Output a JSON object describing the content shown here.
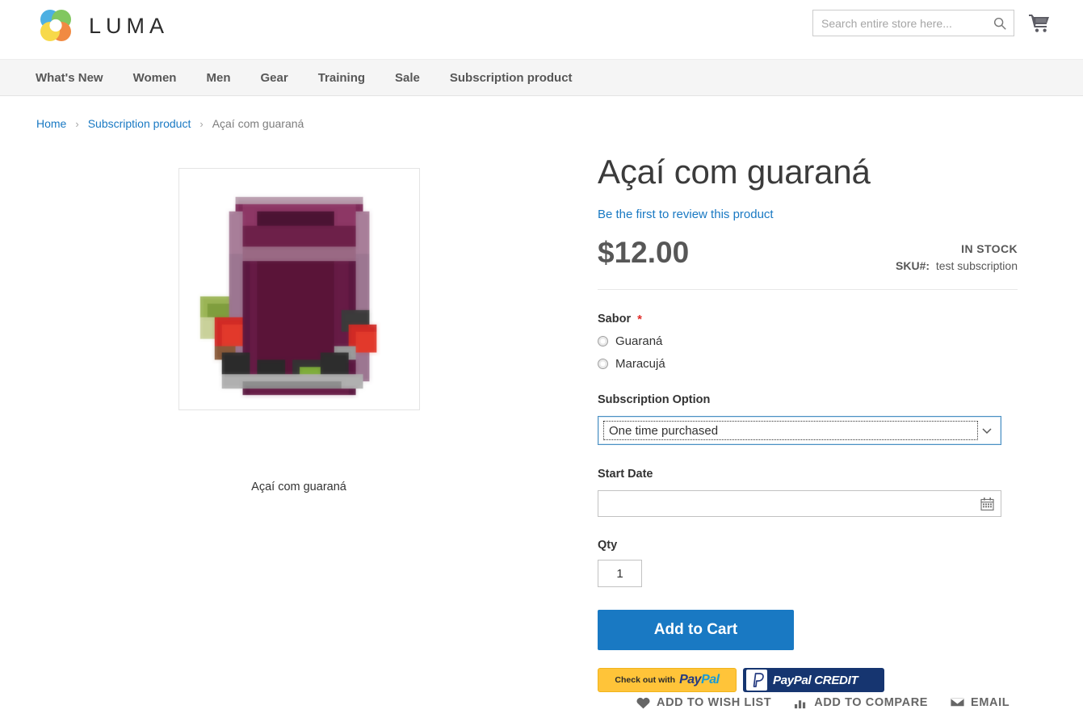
{
  "header": {
    "brand": "LUMA",
    "brand_logo_icon": "luma-rings-logo",
    "search": {
      "placeholder": "Search entire store here...",
      "value": "",
      "icon": "search-icon"
    },
    "cart_icon": "shopping-cart-icon"
  },
  "nav": {
    "items": [
      {
        "label": "What's New"
      },
      {
        "label": "Women"
      },
      {
        "label": "Men"
      },
      {
        "label": "Gear"
      },
      {
        "label": "Training"
      },
      {
        "label": "Sale"
      },
      {
        "label": "Subscription product"
      }
    ]
  },
  "breadcrumb": {
    "home": "Home",
    "category": "Subscription product",
    "current": "Açaí com guaraná",
    "separator": "›"
  },
  "media": {
    "caption": "Açaí com guaraná",
    "alt": "Açaí com guaraná glass with fruits"
  },
  "product": {
    "title": "Açaí com guaraná",
    "review_link": "Be the first to review this product",
    "price": "$12.00",
    "stock_status": "IN STOCK",
    "sku_label": "SKU#:",
    "sku_value": "test subscription"
  },
  "options": {
    "sabor": {
      "label": "Sabor",
      "required_marker": "*",
      "choices": [
        {
          "label": "Guaraná",
          "selected": false
        },
        {
          "label": "Maracujá",
          "selected": false
        }
      ]
    },
    "subscription": {
      "label": "Subscription Option",
      "selected": "One time purchased",
      "chevron_icon": "chevron-down-icon"
    },
    "start_date": {
      "label": "Start Date",
      "value": "",
      "placeholder": "",
      "icon": "calendar-icon"
    },
    "qty": {
      "label": "Qty",
      "value": "1"
    }
  },
  "buttons": {
    "add_to_cart": "Add to Cart",
    "paypal_checkout_pre": "Check out with",
    "paypal_word_pay": "Pay",
    "paypal_word_pal": "Pal",
    "paypal_credit": "PayPal CREDIT",
    "paypal_badge_letter": "P"
  },
  "actions": [
    {
      "label": "Add to Wish List",
      "icon": "heart-icon"
    },
    {
      "label": "Add to Compare",
      "icon": "compare-bars-icon"
    },
    {
      "label": "Email",
      "icon": "envelope-icon"
    }
  ],
  "colors": {
    "accent_blue": "#1979c3",
    "nav_bg": "#f5f5f5",
    "price_gray": "#575757",
    "required_red": "#e02b27",
    "paypal_yellow": "#ffc439",
    "paypal_navy": "#163570"
  }
}
